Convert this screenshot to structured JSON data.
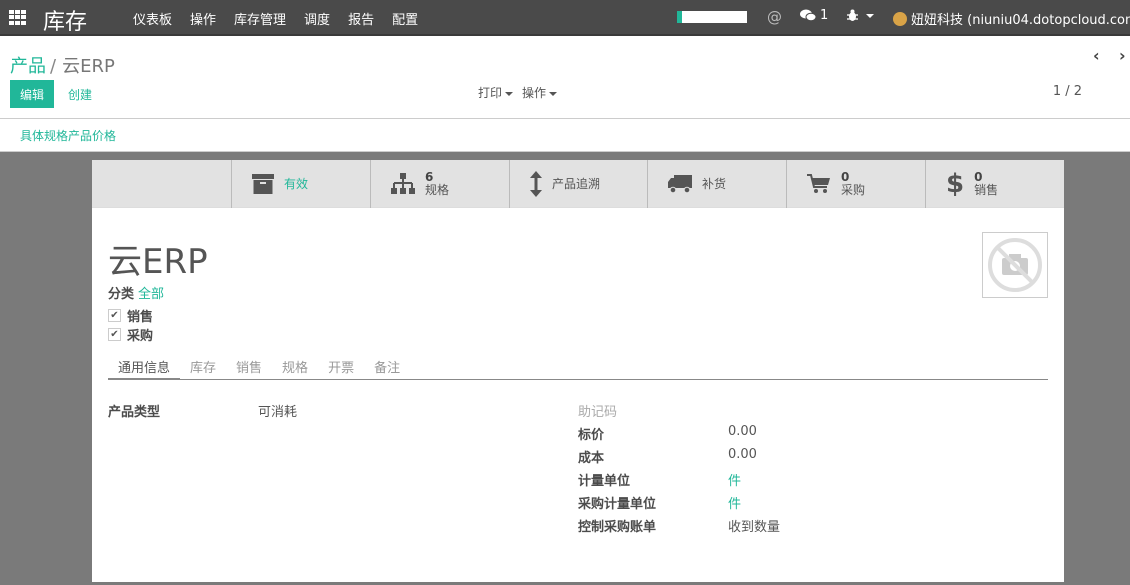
{
  "navbar": {
    "brand": "库存",
    "menu": [
      "仪表板",
      "操作",
      "库存管理",
      "调度",
      "报告",
      "配置"
    ],
    "chat_count": "1",
    "user": "妞妞科技 (niuniu04.dotopcloud.com)"
  },
  "breadcrumb": {
    "parent": "产品",
    "current": "云ERP"
  },
  "toolbar": {
    "edit": "编辑",
    "create": "创建",
    "print": "打印",
    "action": "操作",
    "pager": "1 / 2"
  },
  "subbar": {
    "link": "具体规格产品价格"
  },
  "smart_buttons": [
    {
      "icon": "archive-icon",
      "value": "",
      "label": "有效"
    },
    {
      "icon": "sitemap-icon",
      "value": "6",
      "label": "规格"
    },
    {
      "icon": "arrows-v-icon",
      "value": "",
      "label": "产品追溯"
    },
    {
      "icon": "truck-icon",
      "value": "",
      "label": "补货"
    },
    {
      "icon": "shopping-cart-icon",
      "value": "0",
      "label": "采购"
    },
    {
      "icon": "dollar-icon",
      "value": "0",
      "label": "销售"
    }
  ],
  "product": {
    "name": "云ERP",
    "category_label": "分类",
    "category_value": "全部",
    "sale_ok": "销售",
    "purchase_ok": "采购"
  },
  "tabs": [
    "通用信息",
    "库存",
    "销售",
    "规格",
    "开票",
    "备注"
  ],
  "fields": {
    "type_label": "产品类型",
    "type_value": "可消耗",
    "default_code_label": "助记码",
    "list_price_label": "标价",
    "list_price_value": "0.00",
    "cost_label": "成本",
    "cost_value": "0.00",
    "uom_label": "计量单位",
    "uom_value": "件",
    "po_uom_label": "采购计量单位",
    "po_uom_value": "件",
    "purchase_method_label": "控制采购账单",
    "purchase_method_value": "收到数量"
  },
  "colors": {
    "accent": "#21b799",
    "navbar": "#4a4a4a"
  }
}
